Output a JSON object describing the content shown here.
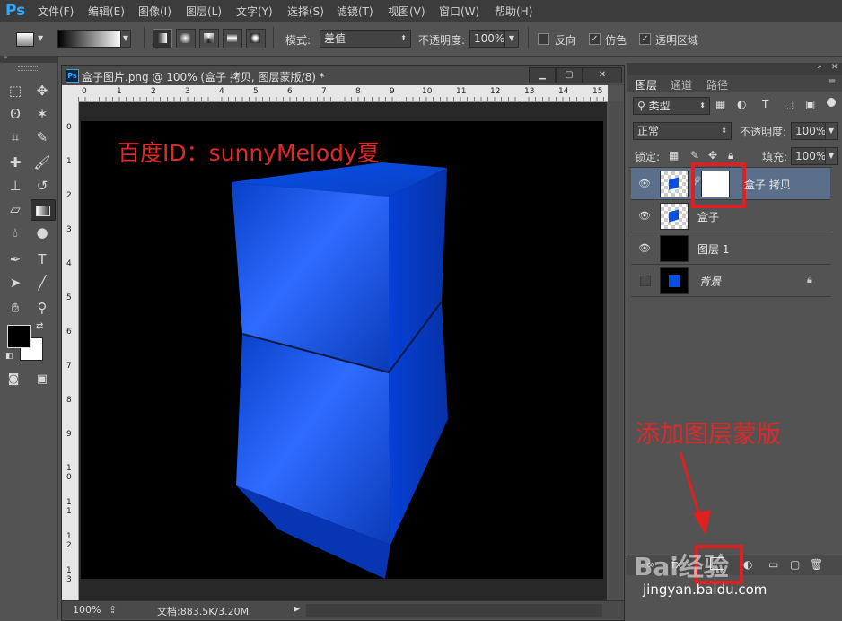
{
  "app": {
    "logo": "Ps"
  },
  "menu": [
    "文件(F)",
    "编辑(E)",
    "图像(I)",
    "图层(L)",
    "文字(Y)",
    "选择(S)",
    "滤镜(T)",
    "视图(V)",
    "窗口(W)",
    "帮助(H)"
  ],
  "options": {
    "mode_label": "模式:",
    "mode_value": "差值",
    "opacity_label": "不透明度:",
    "opacity_value": "100%",
    "reverse_label": "反向",
    "dither_label": "仿色",
    "transparency_label": "透明区域"
  },
  "document": {
    "title": "盒子图片.png @ 100% (盒子 拷贝, 图层蒙版/8) *",
    "ps_icon": "Ps",
    "hruler": [
      "0",
      "1",
      "2",
      "3",
      "4",
      "5",
      "6",
      "7",
      "8",
      "9",
      "10",
      "11",
      "12",
      "13",
      "14",
      "15"
    ],
    "vruler": [
      "0",
      "1",
      "2",
      "3",
      "4",
      "5",
      "6",
      "7",
      "8",
      "9",
      "1\n0",
      "1\n1",
      "1\n2",
      "1\n3"
    ],
    "zoom": "100%",
    "doc_size": "文档:883.5K/3.20M",
    "canvas_text": "百度ID：sunnyMelody夏"
  },
  "panels": {
    "tabs": [
      "图层",
      "通道",
      "路径"
    ],
    "filter_type": "类型",
    "blend_mode": "正常",
    "opacity_label": "不透明度:",
    "opacity_value": "100%",
    "lock_label": "锁定:",
    "fill_label": "填充:",
    "fill_value": "100%",
    "layers": [
      {
        "name": "盒子 拷贝",
        "visible": true,
        "selected": true,
        "has_mask": true
      },
      {
        "name": "盒子",
        "visible": true,
        "selected": false
      },
      {
        "name": "图层 1",
        "visible": true,
        "selected": false
      },
      {
        "name": "背景",
        "visible": false,
        "selected": false,
        "locked": true
      }
    ]
  },
  "annotation": {
    "text": "添加图层蒙版"
  },
  "watermark": {
    "text": "Bai经验",
    "url": "jingyan.baidu.com"
  },
  "colors": {
    "annotation_red": "#e02020",
    "box_blue": "#0a4fe0",
    "selected_layer": "#5b6e8a"
  }
}
